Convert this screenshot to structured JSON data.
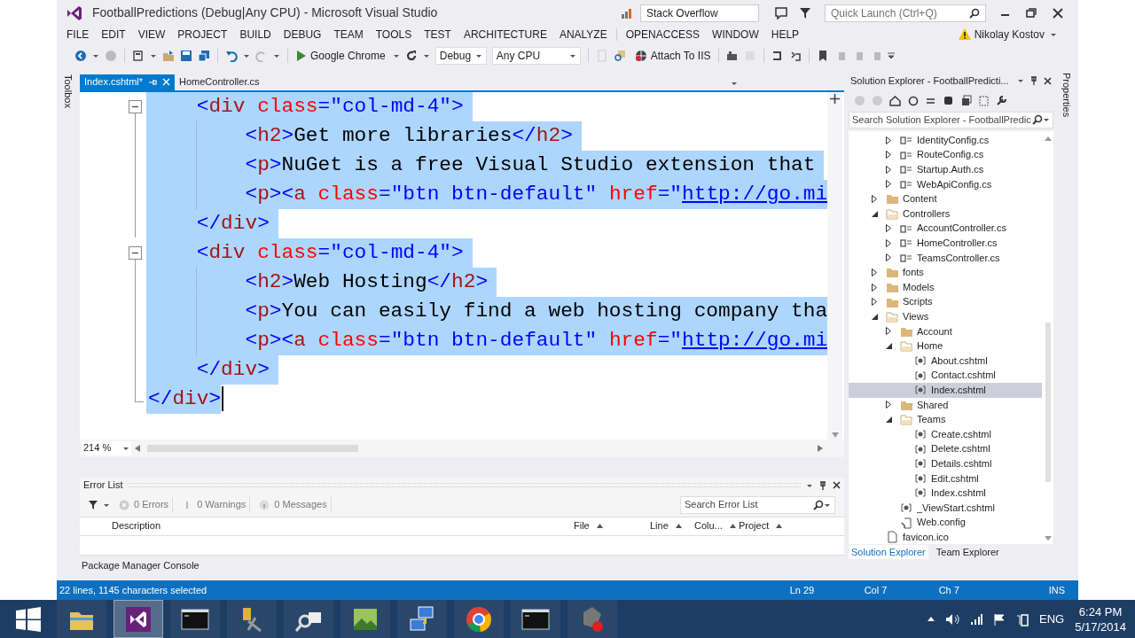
{
  "window": {
    "title": "FootballPredictions (Debug|Any CPU) - Microsoft Visual Studio"
  },
  "title_bar": {
    "feedback_field": {
      "value": "Stack Overflow"
    },
    "quick_launch": {
      "placeholder": "Quick Launch (Ctrl+Q)"
    }
  },
  "menu": [
    "FILE",
    "EDIT",
    "VIEW",
    "PROJECT",
    "BUILD",
    "DEBUG",
    "TEAM",
    "TOOLS",
    "TEST",
    "ARCHITECTURE",
    "ANALYZE",
    "OPENACCESS",
    "WINDOW",
    "HELP"
  ],
  "user": {
    "name": "Nikolay Kostov"
  },
  "toolbar": {
    "run_target": "Google Chrome",
    "configuration": "Debug",
    "platform": "Any CPU",
    "attach": "Attach To IIS"
  },
  "side_strips": {
    "left": "Toolbox",
    "right": "Properties"
  },
  "document_tabs": [
    {
      "label": "Index.cshtml*",
      "selected": true
    },
    {
      "label": "HomeController.cs",
      "selected": false
    }
  ],
  "editor": {
    "zoom": "214 %",
    "lines": [
      {
        "fold_marker": true,
        "selected": true,
        "tokens": [
          {
            "text": "    <",
            "kind": "delim"
          },
          {
            "text": "div",
            "kind": "tag"
          },
          {
            "text": " class",
            "kind": "attr"
          },
          {
            "text": "=",
            "kind": "delim"
          },
          {
            "text": "\"col-md-4\"",
            "kind": "str"
          },
          {
            "text": ">",
            "kind": "delim"
          }
        ]
      },
      {
        "fold_marker": false,
        "selected": true,
        "tokens": [
          {
            "text": "        <",
            "kind": "delim"
          },
          {
            "text": "h2",
            "kind": "tag"
          },
          {
            "text": ">",
            "kind": "delim"
          },
          {
            "text": "Get more libraries",
            "kind": "text"
          },
          {
            "text": "</",
            "kind": "delim"
          },
          {
            "text": "h2",
            "kind": "tag"
          },
          {
            "text": ">",
            "kind": "delim"
          }
        ]
      },
      {
        "fold_marker": false,
        "selected": true,
        "tokens": [
          {
            "text": "        <",
            "kind": "delim"
          },
          {
            "text": "p",
            "kind": "tag"
          },
          {
            "text": ">",
            "kind": "delim"
          },
          {
            "text": "NuGet is a free Visual Studio extension that",
            "kind": "text"
          }
        ]
      },
      {
        "fold_marker": false,
        "selected": true,
        "tokens": [
          {
            "text": "        <",
            "kind": "delim"
          },
          {
            "text": "p",
            "kind": "tag"
          },
          {
            "text": "><",
            "kind": "delim"
          },
          {
            "text": "a",
            "kind": "tag"
          },
          {
            "text": " class",
            "kind": "attr"
          },
          {
            "text": "=",
            "kind": "delim"
          },
          {
            "text": "\"btn btn-default\"",
            "kind": "str"
          },
          {
            "text": " href",
            "kind": "attr"
          },
          {
            "text": "=",
            "kind": "delim"
          },
          {
            "text": "\"",
            "kind": "str"
          },
          {
            "text": "http://go.mi",
            "kind": "link"
          }
        ]
      },
      {
        "fold_marker": false,
        "selected": true,
        "tokens": [
          {
            "text": "    </",
            "kind": "delim"
          },
          {
            "text": "div",
            "kind": "tag"
          },
          {
            "text": ">",
            "kind": "delim"
          }
        ]
      },
      {
        "fold_marker": true,
        "selected": true,
        "tokens": [
          {
            "text": "    <",
            "kind": "delim"
          },
          {
            "text": "div",
            "kind": "tag"
          },
          {
            "text": " class",
            "kind": "attr"
          },
          {
            "text": "=",
            "kind": "delim"
          },
          {
            "text": "\"col-md-4\"",
            "kind": "str"
          },
          {
            "text": ">",
            "kind": "delim"
          }
        ]
      },
      {
        "fold_marker": false,
        "selected": true,
        "tokens": [
          {
            "text": "        <",
            "kind": "delim"
          },
          {
            "text": "h2",
            "kind": "tag"
          },
          {
            "text": ">",
            "kind": "delim"
          },
          {
            "text": "Web Hosting",
            "kind": "text"
          },
          {
            "text": "</",
            "kind": "delim"
          },
          {
            "text": "h2",
            "kind": "tag"
          },
          {
            "text": ">",
            "kind": "delim"
          }
        ]
      },
      {
        "fold_marker": false,
        "selected": true,
        "tokens": [
          {
            "text": "        <",
            "kind": "delim"
          },
          {
            "text": "p",
            "kind": "tag"
          },
          {
            "text": ">",
            "kind": "delim"
          },
          {
            "text": "You can easily find a web hosting company tha",
            "kind": "text"
          }
        ]
      },
      {
        "fold_marker": false,
        "selected": true,
        "tokens": [
          {
            "text": "        <",
            "kind": "delim"
          },
          {
            "text": "p",
            "kind": "tag"
          },
          {
            "text": "><",
            "kind": "delim"
          },
          {
            "text": "a",
            "kind": "tag"
          },
          {
            "text": " class",
            "kind": "attr"
          },
          {
            "text": "=",
            "kind": "delim"
          },
          {
            "text": "\"btn btn-default\"",
            "kind": "str"
          },
          {
            "text": " href",
            "kind": "attr"
          },
          {
            "text": "=",
            "kind": "delim"
          },
          {
            "text": "\"",
            "kind": "str"
          },
          {
            "text": "http://go.mi",
            "kind": "link"
          }
        ]
      },
      {
        "fold_marker": false,
        "selected": true,
        "tokens": [
          {
            "text": "    </",
            "kind": "delim"
          },
          {
            "text": "div",
            "kind": "tag"
          },
          {
            "text": ">",
            "kind": "delim"
          }
        ]
      },
      {
        "fold_marker": false,
        "selected": true,
        "tokens": [
          {
            "text": "</",
            "kind": "delim"
          },
          {
            "text": "div",
            "kind": "tag"
          },
          {
            "text": ">",
            "kind": "delim"
          }
        ]
      }
    ]
  },
  "error_list": {
    "title": "Error List",
    "filters": [
      {
        "label": "0 Errors",
        "kind": "error"
      },
      {
        "label": "0 Warnings",
        "kind": "warning"
      },
      {
        "label": "0 Messages",
        "kind": "info"
      }
    ],
    "search": {
      "placeholder": "Search Error List"
    },
    "columns": [
      "Description",
      "File",
      "Line",
      "Colu...",
      "Project"
    ]
  },
  "bottom_tabs": [
    {
      "label": "Package Manager Console"
    }
  ],
  "solution_explorer": {
    "title": "Solution Explorer - FootballPredicti...",
    "search": {
      "placeholder": "Search Solution Explorer - FootballPredic"
    },
    "tree": [
      {
        "children": [
          {
            "label": "IdentityConfig.cs",
            "kind": "csharp",
            "expanded": false,
            "selected": false
          },
          {
            "label": "RouteConfig.cs",
            "kind": "csharp",
            "expanded": false,
            "selected": false
          },
          {
            "label": "Startup.Auth.cs",
            "kind": "csharp",
            "expanded": false,
            "selected": false
          },
          {
            "label": "WebApiConfig.cs",
            "kind": "csharp",
            "expanded": false,
            "selected": false
          }
        ]
      },
      {
        "label": "Content",
        "kind": "folder",
        "expanded": false,
        "selected": false
      },
      {
        "label": "Controllers",
        "kind": "folder",
        "expanded": true,
        "selected": false,
        "children": [
          {
            "label": "AccountController.cs",
            "kind": "csharp",
            "expanded": false,
            "selected": false
          },
          {
            "label": "HomeController.cs",
            "kind": "csharp",
            "expanded": false,
            "selected": false
          },
          {
            "label": "TeamsController.cs",
            "kind": "csharp",
            "expanded": false,
            "selected": false
          }
        ]
      },
      {
        "label": "fonts",
        "kind": "folder",
        "expanded": false,
        "selected": false
      },
      {
        "label": "Models",
        "kind": "folder",
        "expanded": false,
        "selected": false
      },
      {
        "label": "Scripts",
        "kind": "folder",
        "expanded": false,
        "selected": false
      },
      {
        "label": "Views",
        "kind": "folder",
        "expanded": true,
        "selected": false,
        "children": [
          {
            "label": "Account",
            "kind": "folder",
            "expanded": false,
            "selected": false
          },
          {
            "label": "Home",
            "kind": "folder",
            "expanded": true,
            "selected": false,
            "children": [
              {
                "label": "About.cshtml",
                "kind": "razor",
                "selected": false
              },
              {
                "label": "Contact.cshtml",
                "kind": "razor",
                "selected": false
              },
              {
                "label": "Index.cshtml",
                "kind": "razor",
                "selected": true
              }
            ]
          },
          {
            "label": "Shared",
            "kind": "folder",
            "expanded": false,
            "selected": false
          },
          {
            "label": "Teams",
            "kind": "folder",
            "expanded": true,
            "selected": false,
            "children": [
              {
                "label": "Create.cshtml",
                "kind": "razor",
                "selected": false
              },
              {
                "label": "Delete.cshtml",
                "kind": "razor",
                "selected": false
              },
              {
                "label": "Details.cshtml",
                "kind": "razor",
                "selected": false
              },
              {
                "label": "Edit.cshtml",
                "kind": "razor",
                "selected": false
              },
              {
                "label": "Index.cshtml",
                "kind": "razor",
                "selected": false
              }
            ]
          },
          {
            "label": "_ViewStart.cshtml",
            "kind": "razor",
            "selected": false
          },
          {
            "label": "Web.config",
            "kind": "config",
            "selected": false
          }
        ]
      },
      {
        "label": "favicon.ico",
        "kind": "file",
        "selected": false
      }
    ],
    "tabs": [
      {
        "label": "Solution Explorer",
        "selected": true
      },
      {
        "label": "Team Explorer",
        "selected": false
      }
    ]
  },
  "status_bar": {
    "message": "22 lines, 1145 characters selected",
    "line": "Ln 29",
    "column": "Col 7",
    "char": "Ch 7",
    "mode": "INS"
  },
  "taskbar": {
    "apps": [
      {
        "kind": "explorer",
        "selected": false
      },
      {
        "kind": "studio",
        "selected": true
      },
      {
        "kind": "terminal",
        "selected": false
      },
      {
        "kind": "tools",
        "selected": false
      },
      {
        "kind": "magnifier",
        "selected": false
      },
      {
        "kind": "image",
        "selected": false
      },
      {
        "kind": "network",
        "selected": false
      },
      {
        "kind": "browser",
        "selected": false
      },
      {
        "kind": "terminal",
        "selected": false
      },
      {
        "kind": "stop",
        "selected": false
      }
    ],
    "tray": {
      "language": "ENG",
      "time": "6:24 PM",
      "date": "5/17/2014"
    }
  }
}
